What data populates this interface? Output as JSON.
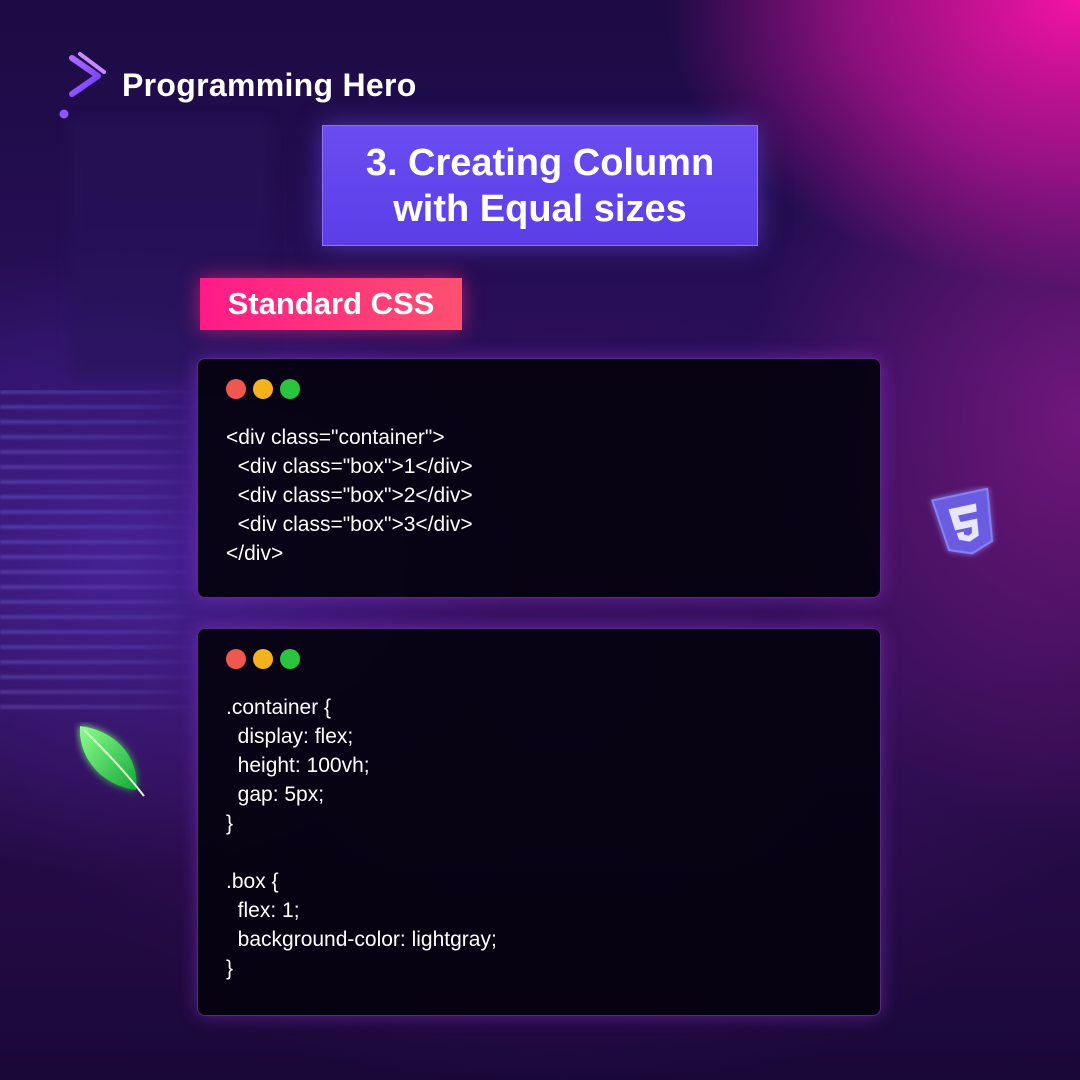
{
  "brand": {
    "name": "Programming Hero"
  },
  "title": {
    "text": "3. Creating Column\nwith Equal sizes"
  },
  "tag": {
    "label": "Standard CSS"
  },
  "panels": [
    {
      "code": "<div class=\"container\">\n  <div class=\"box\">1</div>\n  <div class=\"box\">2</div>\n  <div class=\"box\">3</div>\n</div>"
    },
    {
      "code": ".container {\n  display: flex;\n  height: 100vh;\n  gap: 5px;\n}\n\n.box {\n  flex: 1;\n  background-color: lightgray;\n}"
    }
  ],
  "window_dots": {
    "colors": [
      "#f0584f",
      "#f5b21f",
      "#29c440"
    ]
  },
  "icons": {
    "logo": "programming-hero-logo-icon",
    "leaf": "mongodb-leaf-icon",
    "badge": "css3-shield-icon"
  },
  "colors": {
    "title_bg": "#5f43ea",
    "tag_bg": "#ff2a80",
    "panel_bg": "#05030f",
    "panel_border": "#9650dc",
    "text": "#ffffff"
  }
}
